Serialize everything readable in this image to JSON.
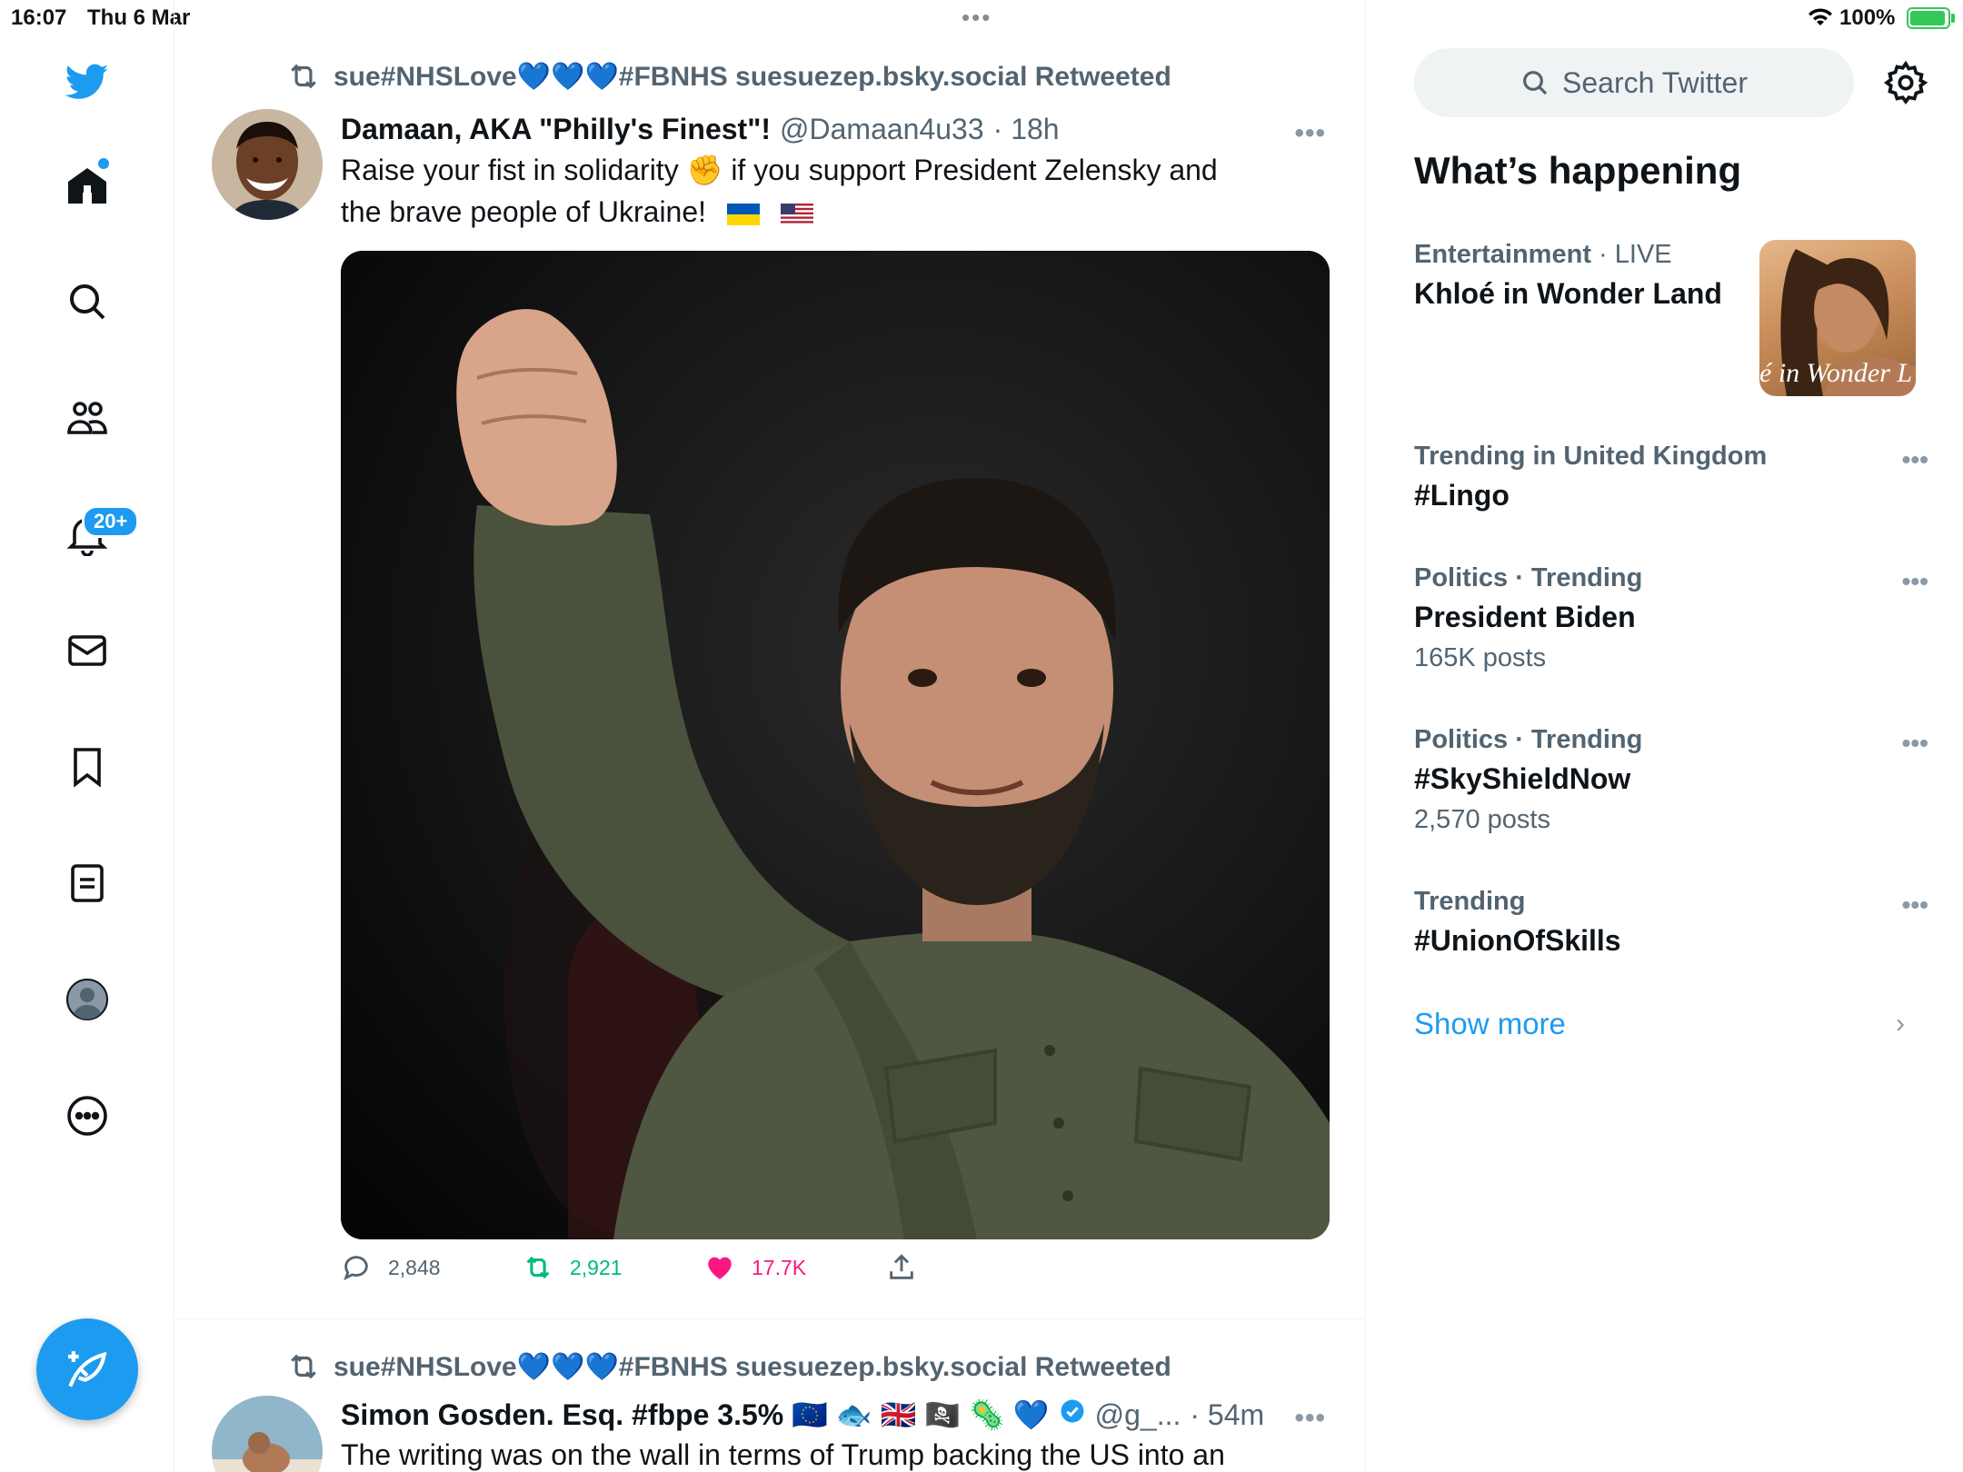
{
  "status_bar": {
    "time": "16:07",
    "date": "Thu 6 Mar",
    "battery": "100%",
    "multitask_dots": "•••"
  },
  "nav": {
    "notifications_badge": "20+",
    "icons": [
      "twitter-bird-icon",
      "home-icon",
      "search-icon",
      "communities-icon",
      "notifications-icon",
      "messages-icon",
      "bookmarks-icon",
      "lists-icon",
      "profile-icon",
      "more-icon"
    ],
    "accent_color": "#1d9bf0"
  },
  "timeline": {
    "tweets": [
      {
        "retweeted_by": "sue#NHSLove💙💙💙#FBNHS suesuezep.bsky.social Retweeted",
        "author_name": "Damaan, AKA \"Philly's Finest\"!",
        "handle": "@Damaan4u33",
        "time": "· 18h",
        "text_line1": "Raise your fist in solidarity ✊  if you support President Zelensky and",
        "text_line2": "the brave people of Ukraine!",
        "more": "•••",
        "replies": "2,848",
        "retweets": "2,921",
        "likes": "17.7K"
      },
      {
        "retweeted_by": "sue#NHSLove💙💙💙#FBNHS suesuezep.bsky.social Retweeted",
        "author_name": "Simon Gosden. Esq. #fbpe 3.5% 🇪🇺 🐟 🇬🇧 🏴‍☠️ 🦠 💙",
        "handle": "@g_...",
        "time": "· 54m",
        "text_line1": "The writing was on the wall in terms of Trump backing the US into an",
        "more": "•••"
      }
    ]
  },
  "right": {
    "search_placeholder": "Search Twitter",
    "section_title": "What’s happening",
    "trends": [
      {
        "category": "Entertainment",
        "live": "· LIVE",
        "title": "Khloé in Wonder Land",
        "thumb_text": "é in Wonder L"
      },
      {
        "category": "Trending in United Kingdom",
        "title": "#Lingo"
      },
      {
        "category": "Politics · Trending",
        "title": "President Biden",
        "count": "165K posts"
      },
      {
        "category": "Politics · Trending",
        "title": "#SkyShieldNow",
        "count": "2,570 posts"
      },
      {
        "category": "Trending",
        "title": "#UnionOfSkills"
      }
    ],
    "show_more": "Show more",
    "more": "•••",
    "chevron": "›"
  }
}
